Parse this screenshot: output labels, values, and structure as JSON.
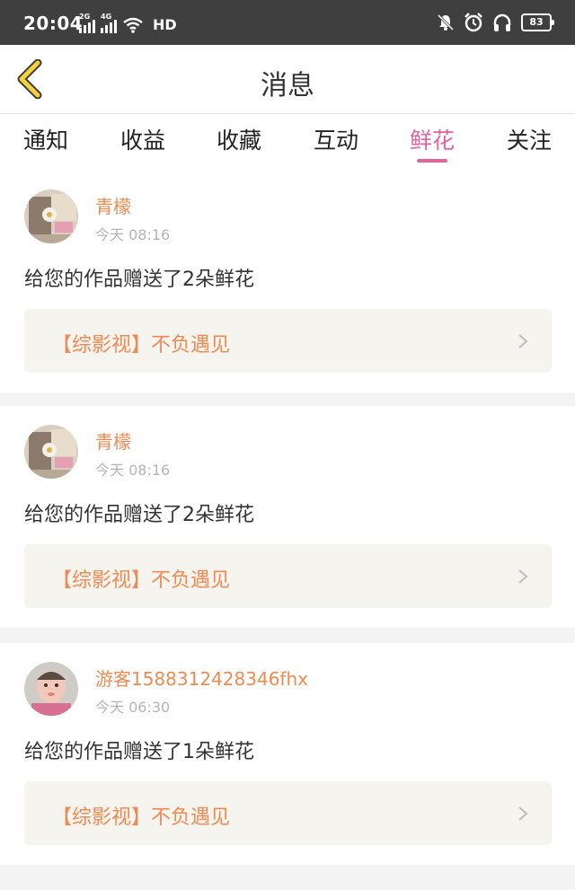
{
  "status_bar": {
    "time": "20:04",
    "net1": "2G",
    "net2": "4G",
    "hd": "HD",
    "battery": "83"
  },
  "header": {
    "title": "消息"
  },
  "tabs": [
    {
      "label": "通知",
      "active": false
    },
    {
      "label": "收益",
      "active": false
    },
    {
      "label": "收藏",
      "active": false
    },
    {
      "label": "互动",
      "active": false
    },
    {
      "label": "鲜花",
      "active": true
    },
    {
      "label": "关注",
      "active": false
    }
  ],
  "messages": [
    {
      "user": "青檬",
      "time": "今天 08:16",
      "text": "给您的作品赠送了2朵鲜花",
      "work": "【综影视】不负遇见"
    },
    {
      "user": "青檬",
      "time": "今天 08:16",
      "text": "给您的作品赠送了2朵鲜花",
      "work": "【综影视】不负遇见"
    },
    {
      "user": "游客1588312428346fhx",
      "time": "今天 06:30",
      "text": "给您的作品赠送了1朵鲜花",
      "work": "【综影视】不负遇见"
    }
  ],
  "colors": {
    "accent": "#e2659f",
    "highlight": "#f08a52",
    "back_arrow": "#f3d23c"
  }
}
